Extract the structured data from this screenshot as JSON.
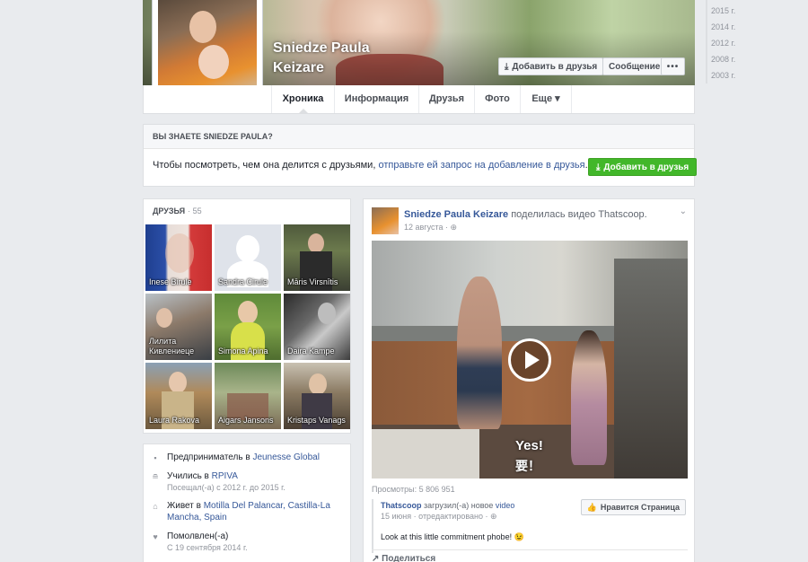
{
  "profile": {
    "name_line1": "Sniedze Paula",
    "name_line2": "Keizare",
    "add_friend_label": "Добавить в друзья",
    "message_label": "Сообщение",
    "more_label": "•••"
  },
  "tabs": [
    {
      "label": "Хроника",
      "active": true
    },
    {
      "label": "Информация"
    },
    {
      "label": "Друзья"
    },
    {
      "label": "Фото"
    },
    {
      "label": "Еще ▾"
    }
  ],
  "years": [
    "2015 г.",
    "2014 г.",
    "2012 г.",
    "2008 г.",
    "2003 г."
  ],
  "know_box": {
    "title": "ВЫ ЗНАЕТЕ SNIEDZE PAULA?",
    "text_before": "Чтобы посмотреть, чем она делится с друзьями, ",
    "text_link": "отправьте ей запрос на добавление в друзья",
    "text_after": ".",
    "button_label": "Добавить в друзья"
  },
  "friends": {
    "title": "ДРУЗЬЯ",
    "count": "· 55",
    "items": [
      {
        "name": "Inese Birule"
      },
      {
        "name": "Sandra Cirule"
      },
      {
        "name": "Māris Virsnītis"
      },
      {
        "name": "Лилита Кивлениеце"
      },
      {
        "name": "Simona Apina"
      },
      {
        "name": "Daira Kampe"
      },
      {
        "name": "Laura Rakova"
      },
      {
        "name": "Aigars Jansons"
      },
      {
        "name": "Kristaps Vanags"
      }
    ]
  },
  "about": {
    "work_prefix": "Предприниматель в ",
    "work_link": "Jeunesse Global",
    "study_prefix": "Учились в ",
    "study_link": "RPIVA",
    "study_sub": "Посещал(-а) с 2012 г. до 2015 г.",
    "lives_prefix": "Живет в ",
    "lives_link": "Motilla Del Palancar, Castilla-La Mancha, Spain",
    "engaged": "Помолвлен(-а)",
    "engaged_sub": "С 19 сентября 2014 г."
  },
  "post": {
    "author": "Sniedze Paula Keizare",
    "action": " поделилась видео Thatscoop.",
    "date": "12 августа · ⊕",
    "subtitle_en": "Yes!",
    "subtitle_cn": "要！",
    "views": "Просмотры: 5 806 951",
    "shared_page": "Thatscoop",
    "shared_action": " загрузил(-а) новое ",
    "shared_link": "video",
    "shared_meta": "15 июня · отредактировано · ⊕",
    "shared_text": "Look at this little commitment phobe! 😉",
    "like_page_label": "Нравится Страница",
    "share_label": "Поделиться"
  }
}
